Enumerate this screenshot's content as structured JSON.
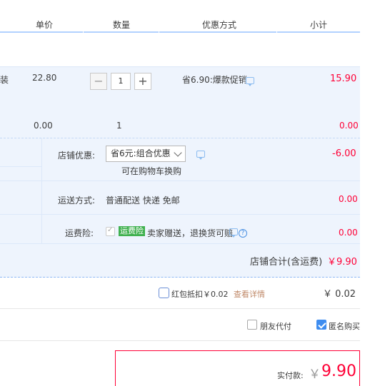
{
  "header": {
    "col_price": "单价",
    "col_qty": "数量",
    "col_promo": "优惠方式",
    "col_subtotal": "小计"
  },
  "item": {
    "name_fragment": "装",
    "unit_price": "22.80",
    "quantity": "1",
    "promo": "省6.90:爆款促销",
    "subtotal": "15.90",
    "minus_label": "−",
    "plus_label": "+"
  },
  "addon": {
    "unit_price": "0.00",
    "quantity": "1",
    "subtotal": "0.00"
  },
  "shop": {
    "discount_label": "店铺优惠:",
    "discount_selected": "省6元:组合优惠",
    "discount_note": "可在购物车换购",
    "discount_value": "-6.00",
    "shipping_label": "运送方式:",
    "shipping_value": "普通配送 快递 免邮",
    "shipping_cost": "0.00",
    "insurance_label": "运费险:",
    "insurance_badge": "运费险",
    "insurance_text": "卖家赠送，退换货可赔",
    "insurance_cost": "0.00",
    "total_label": "店铺合计(含运费)",
    "total_value": "￥9.90"
  },
  "redpacket": {
    "label": "红包抵扣￥0.02",
    "link": "查看详情",
    "value": "￥ 0.02"
  },
  "options": {
    "friend_pay": "朋友代付",
    "anonymous": "匿名购买"
  },
  "payment": {
    "label": "实付款:",
    "currency": "￥",
    "amount": "9.90"
  },
  "colors": {
    "accent_red": "#ff0036",
    "band_blue": "#eef4fd",
    "check_blue": "#3e8df0",
    "badge_green": "#40b14f"
  }
}
